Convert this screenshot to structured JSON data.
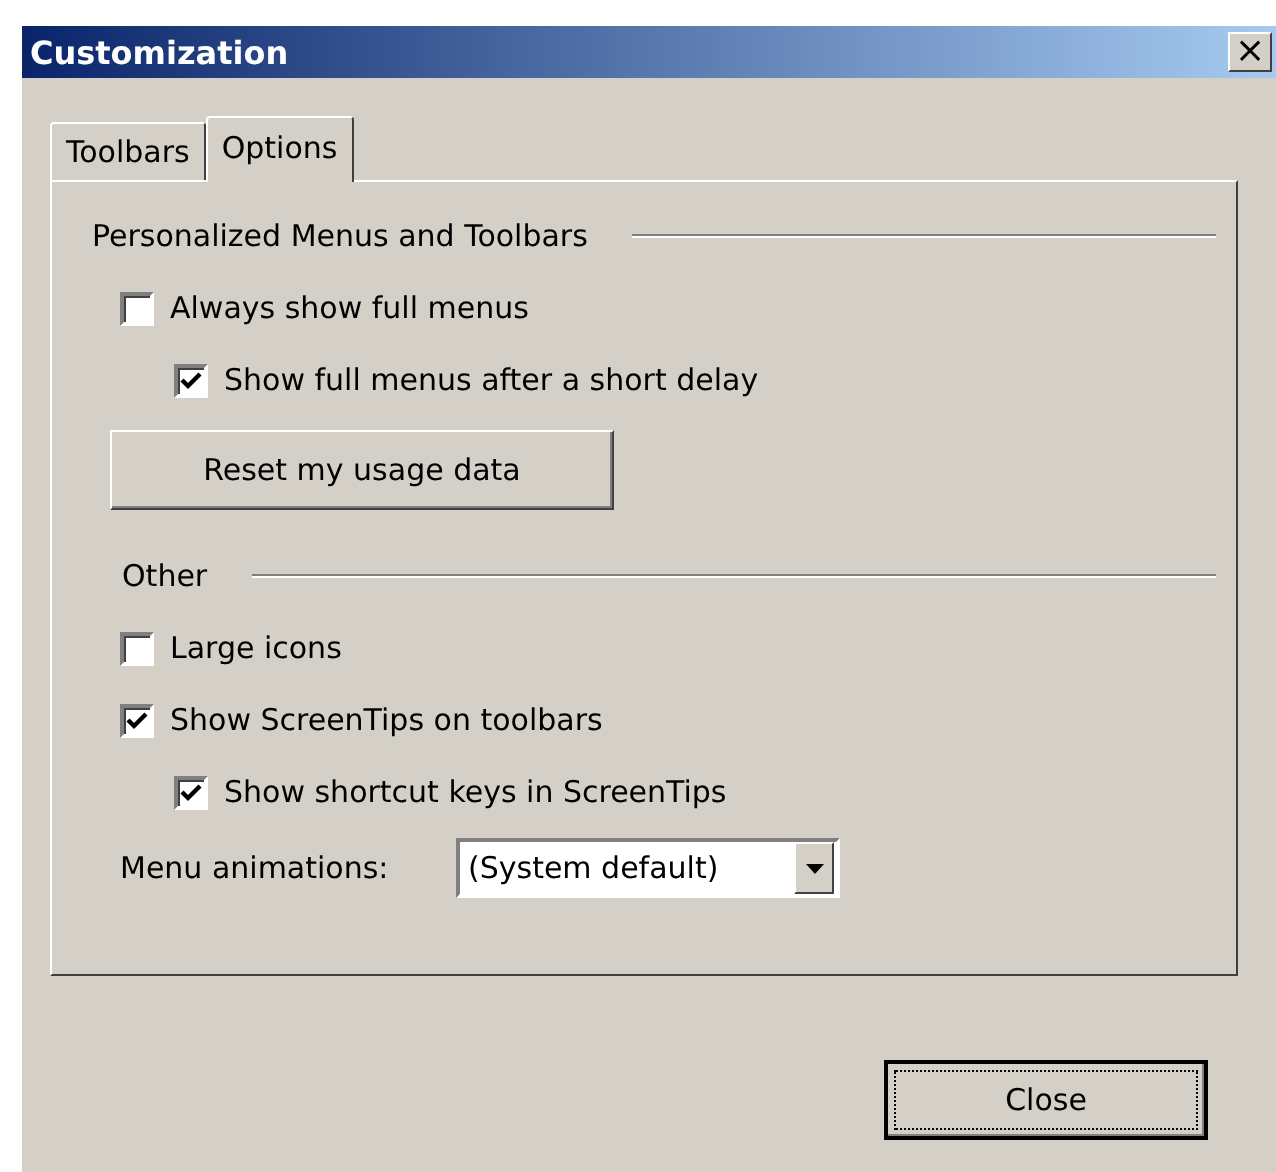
{
  "window": {
    "title": "Customization",
    "close_symbol": "×"
  },
  "tabs": [
    {
      "label": "Toolbars",
      "selected": false
    },
    {
      "label": "Options",
      "selected": true
    }
  ],
  "items": [
    {
      "kind": "heading",
      "label": "Personalized Menus and Toolbars"
    },
    {
      "kind": "checkbox",
      "label": "Always show full menus",
      "checked": false,
      "children": [
        {
          "kind": "checkbox",
          "label": "Show full menus after a short delay",
          "checked": true
        }
      ]
    },
    {
      "kind": "button",
      "label": "Reset my usage data"
    },
    {
      "kind": "heading",
      "label": "Other"
    },
    {
      "kind": "checkbox",
      "label": "Large icons",
      "checked": false
    },
    {
      "kind": "checkbox",
      "label": "Show ScreenTips on toolbars",
      "checked": true,
      "children": [
        {
          "kind": "checkbox",
          "label": "Show shortcut keys in ScreenTips",
          "checked": true
        }
      ]
    },
    {
      "kind": "dropdown",
      "label": "Menu animations:",
      "value": "(System default)"
    }
  ],
  "buttons": [
    "Close"
  ]
}
